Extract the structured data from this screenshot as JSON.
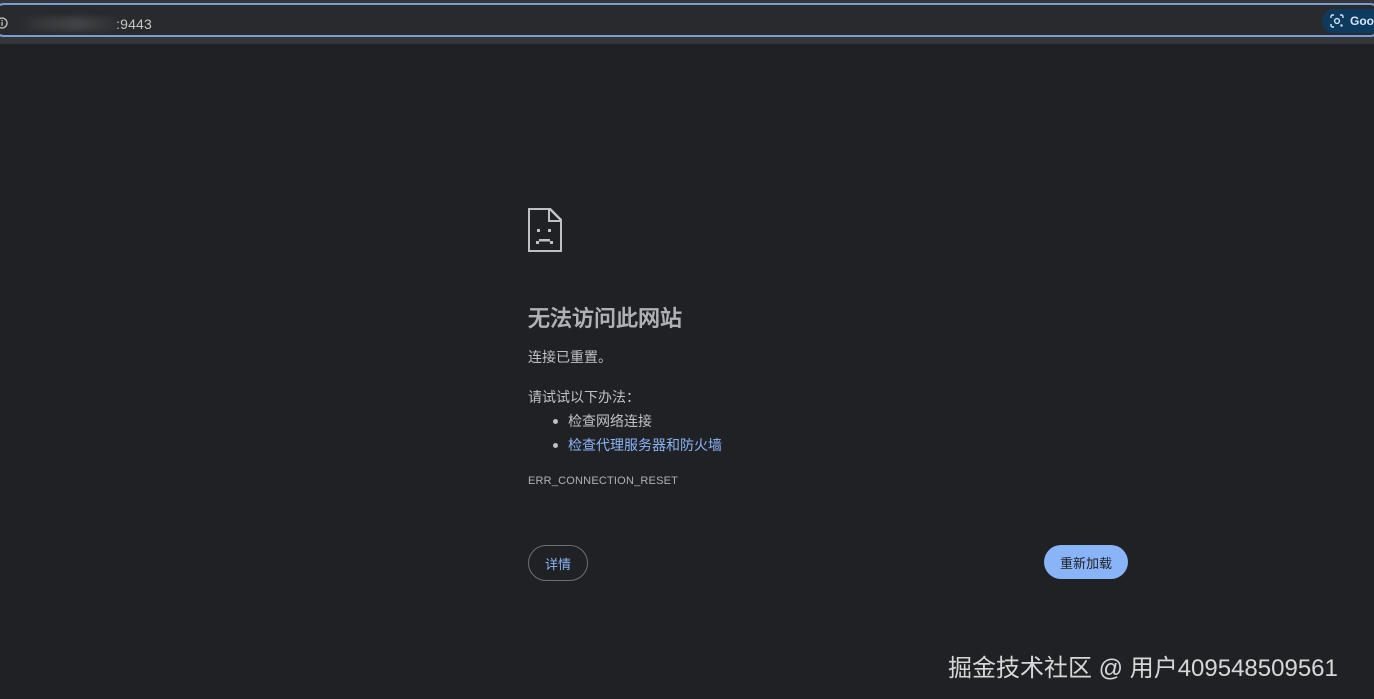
{
  "address_bar": {
    "url": ":9443",
    "lens_label": "Goo"
  },
  "error_page": {
    "title": "无法访问此网站",
    "message": "连接已重置。",
    "try_label": "请试试以下办法：",
    "suggestions": [
      "检查网络连接",
      "检查代理服务器和防火墙"
    ],
    "error_code": "ERR_CONNECTION_RESET",
    "details_button": "详情",
    "reload_button": "重新加载"
  },
  "watermark": "掘金技术社区 @ 用户409548509561",
  "colors": {
    "background": "#202124",
    "link": "#8ab4f8",
    "omnibox_border": "#7c9cd6"
  },
  "icons": {
    "address_info": "info-icon",
    "lens": "lens-icon",
    "error": "sad-page-icon"
  }
}
